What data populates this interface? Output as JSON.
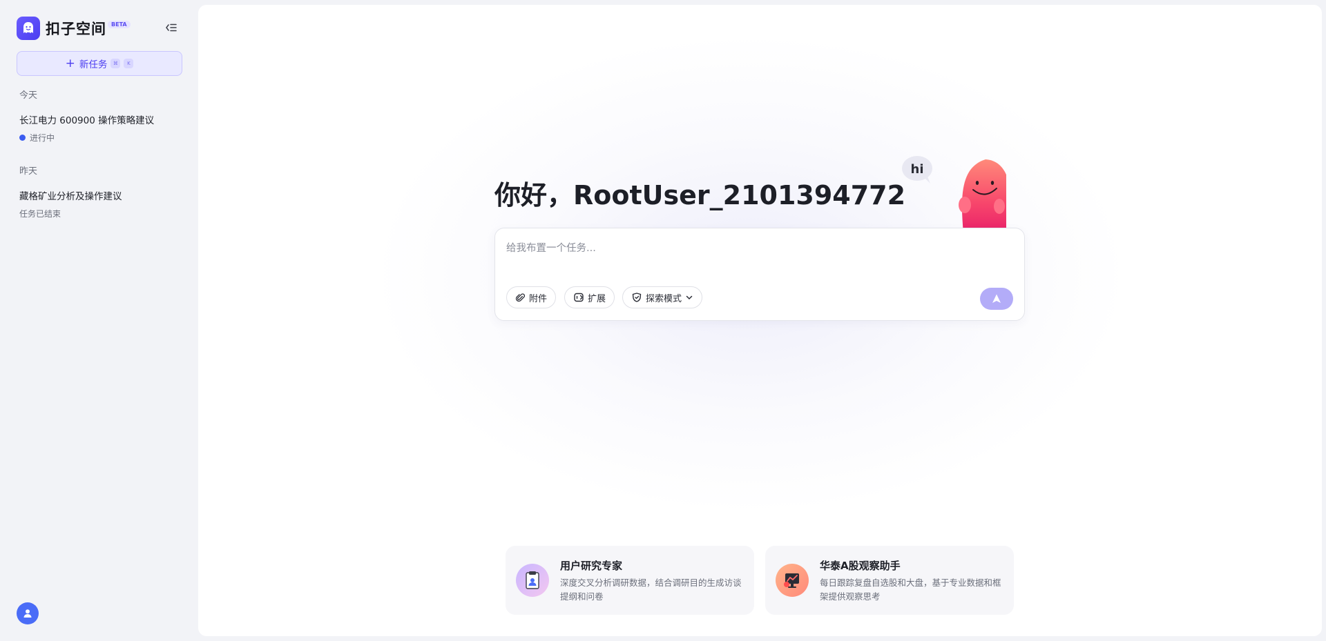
{
  "sidebar": {
    "brand_name": "扣子空间",
    "beta_label": "BETA",
    "new_task": {
      "label": "新任务",
      "shortcut_keys": [
        "⌘",
        "K"
      ]
    },
    "sections": [
      {
        "label": "今天",
        "items": [
          {
            "title": "长江电力 600900 操作策略建议",
            "status": "进行中",
            "status_color": "#3b5cf0"
          }
        ]
      },
      {
        "label": "昨天",
        "items": [
          {
            "title": "藏格矿业分析及操作建议",
            "status": "任务已结束"
          }
        ]
      }
    ]
  },
  "main": {
    "greeting": "你好，RootUser_2101394772",
    "mascot_speech": "hi",
    "composer": {
      "placeholder": "给我布置一个任务...",
      "attach_label": "附件",
      "extension_label": "扩展",
      "mode_label": "探索模式"
    },
    "cards": [
      {
        "title": "用户研究专家",
        "description": "深度交叉分析调研数据，结合调研目的生成访谈提纲和问卷",
        "icon": "clipboard-user-icon"
      },
      {
        "title": "华泰A股观察助手",
        "description": "每日跟踪复盘自选股和大盘，基于专业数据和框架提供观察思考",
        "icon": "stock-chart-icon"
      }
    ]
  },
  "colors": {
    "accent": "#4b3df0",
    "send_button": "#b3acf8",
    "avatar": "#4a6cf7"
  }
}
